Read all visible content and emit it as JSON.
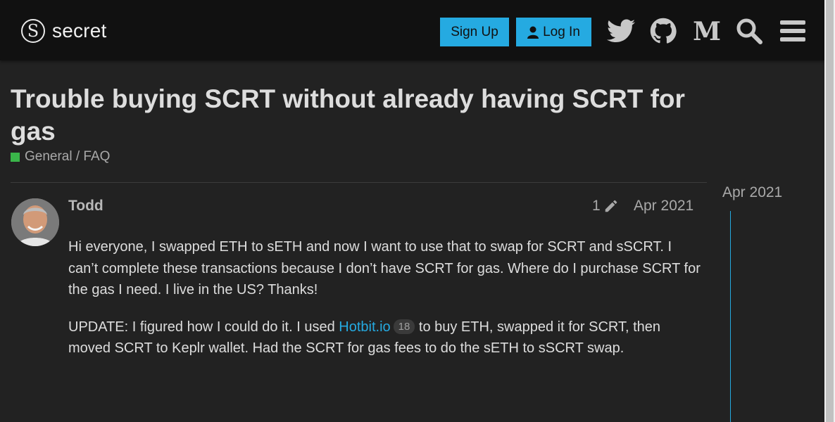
{
  "header": {
    "logo_glyph": "S",
    "logo_text": "secret",
    "signup_label": "Sign Up",
    "login_label": "Log In",
    "icons": [
      "twitter-icon",
      "github-icon",
      "medium-icon",
      "search-icon",
      "hamburger-menu-icon"
    ],
    "accent_color": "#25aae1"
  },
  "topic": {
    "title": "Trouble buying SCRT without already having SCRT for gas",
    "category": "General / FAQ",
    "category_color": "#3ab54a"
  },
  "post": {
    "author": "Todd",
    "edit_count": "1",
    "date": "Apr 2021",
    "paragraph1": "Hi everyone, I swapped ETH to sETH and now I want to use that to swap for SCRT and sSCRT. I can’t complete these transactions because I don’t have SCRT for gas. Where do I purchase SCRT for the gas I need. I live in the US? Thanks!",
    "paragraph2_before": "UPDATE: I figured how I could do it. I used ",
    "link_text": "Hotbit.io",
    "link_clicks": "18",
    "paragraph2_after": " to buy ETH, swapped it for SCRT, then moved SCRT to Keplr wallet. Had the SCRT for gas fees to do the sETH to sSCRT swap."
  },
  "timeline": {
    "date": "Apr 2021"
  }
}
